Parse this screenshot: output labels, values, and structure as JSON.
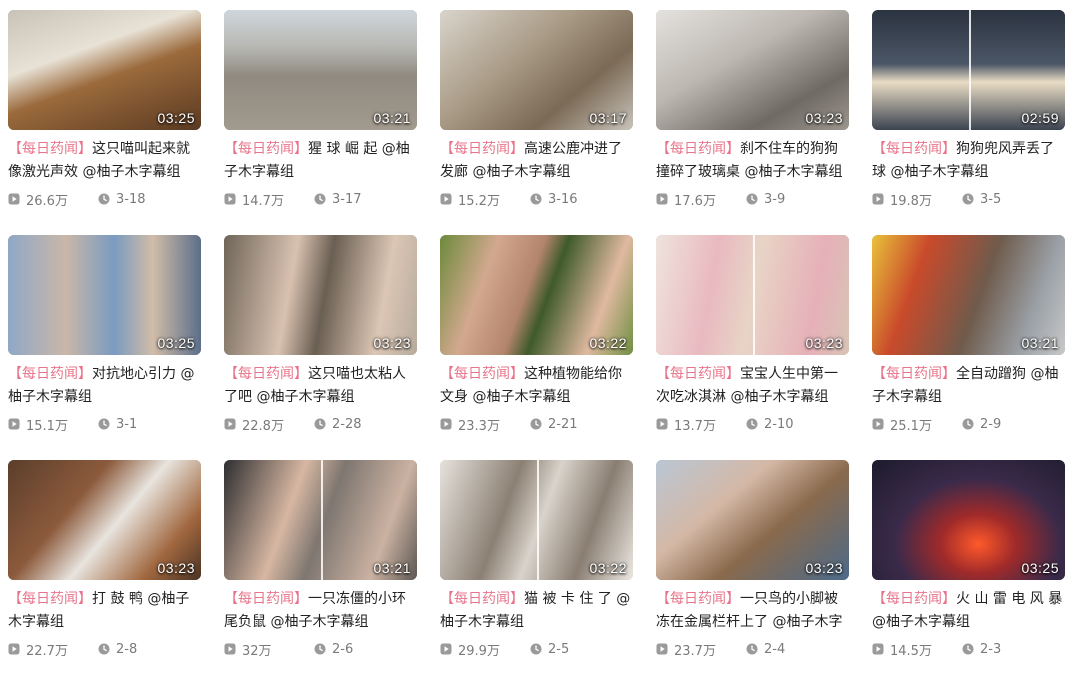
{
  "tag": "【每日药闻】",
  "videos": [
    {
      "duration": "03:25",
      "title": "这只喵叫起来就像激光声效 @柚子木字幕组",
      "views": "26.6万",
      "date": "3-18",
      "thumb": "caracal-in-carrier"
    },
    {
      "duration": "03:21",
      "title": "猩 球 崛 起 @柚子木字幕组",
      "views": "14.7万",
      "date": "3-17",
      "thumb": "monkeys-on-street"
    },
    {
      "duration": "03:17",
      "title": "高速公鹿冲进了发廊 @柚子木字幕组",
      "views": "15.2万",
      "date": "3-16",
      "thumb": "deer-in-salon"
    },
    {
      "duration": "03:23",
      "title": "刹不住车的狗狗撞碎了玻璃桌 @柚子木字幕组",
      "views": "17.6万",
      "date": "3-9",
      "thumb": "dog-glass-table"
    },
    {
      "duration": "02:59",
      "title": "狗狗兜风弄丢了球 @柚子木字幕组",
      "views": "19.8万",
      "date": "3-5",
      "thumb": "dog-in-car"
    },
    {
      "duration": "03:25",
      "title": "对抗地心引力 @柚子木字幕组",
      "views": "15.1万",
      "date": "3-1",
      "thumb": "faces-gravity"
    },
    {
      "duration": "03:23",
      "title": "这只喵也太粘人了吧 @柚子木字幕组",
      "views": "22.8万",
      "date": "2-28",
      "thumb": "cat-and-woman"
    },
    {
      "duration": "03:22",
      "title": "这种植物能给你文身 @柚子木字幕组",
      "views": "23.3万",
      "date": "2-21",
      "thumb": "fern-on-hand"
    },
    {
      "duration": "03:23",
      "title": "宝宝人生中第一次吃冰淇淋 @柚子木字幕组",
      "views": "13.7万",
      "date": "2-10",
      "thumb": "baby-ice-cream"
    },
    {
      "duration": "03:21",
      "title": "全自动蹭狗 @柚子木字幕组",
      "views": "25.1万",
      "date": "2-9",
      "thumb": "man-petting-dog"
    },
    {
      "duration": "03:23",
      "title": "打 鼓 鸭 @柚子木字幕组",
      "views": "22.7万",
      "date": "2-8",
      "thumb": "duck-drum"
    },
    {
      "duration": "03:21",
      "title": "一只冻僵的小环尾负鼠 @柚子木字幕组",
      "views": "32万",
      "date": "2-6",
      "thumb": "possum-in-hand"
    },
    {
      "duration": "03:22",
      "title": "猫 被 卡 住 了 @柚子木字幕组",
      "views": "29.9万",
      "date": "2-5",
      "thumb": "cat-stuck-door"
    },
    {
      "duration": "03:23",
      "title": "一只鸟的小脚被冻在金属栏杆上了 @柚子木字幕组",
      "views": "23.7万",
      "date": "2-4",
      "thumb": "bird-in-glove"
    },
    {
      "duration": "03:25",
      "title": "火 山 雷 电 风 暴 @柚子木字幕组",
      "views": "14.5万",
      "date": "2-3",
      "thumb": "volcano-lightning"
    }
  ],
  "colors": {
    "tag": "#e8758b",
    "meta": "#7a7a7a",
    "icon": "#9a9a9a"
  }
}
